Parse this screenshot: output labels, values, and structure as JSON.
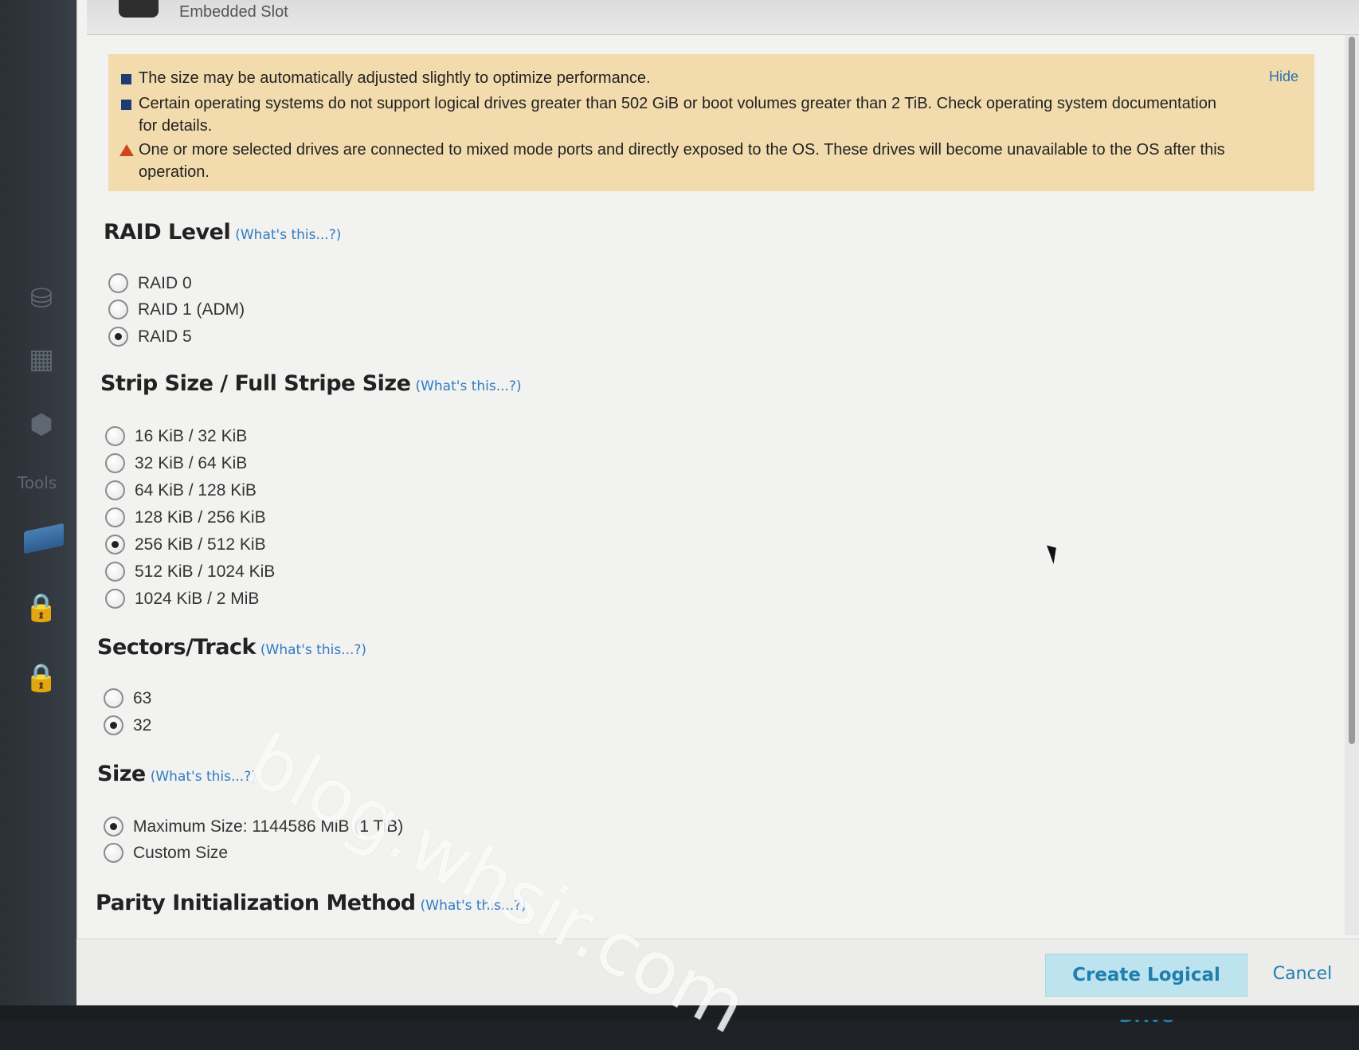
{
  "titlebar": {
    "slot_label": "Embedded Slot"
  },
  "sidebar": {
    "tools_label": "Tools"
  },
  "alert": {
    "messages": [
      "The size may be automatically adjusted slightly to optimize performance.",
      "Certain operating systems do not support logical drives greater than 502 GiB or boot volumes greater than 2 TiB. Check operating system documentation for details.",
      "One or more selected drives are connected to mixed mode ports and directly exposed to the OS. These drives will become unavailable to the OS after this operation."
    ],
    "hide_label": "Hide"
  },
  "raid_level": {
    "title": "RAID Level",
    "help": "(What's this...?)",
    "options": [
      "RAID 0",
      "RAID 1 (ADM)",
      "RAID 5"
    ],
    "selected": "RAID 5"
  },
  "strip_size": {
    "title": "Strip Size / Full Stripe Size",
    "help": "(What's this...?)",
    "options": [
      "16 KiB / 32 KiB",
      "32 KiB / 64 KiB",
      "64 KiB / 128 KiB",
      "128 KiB / 256 KiB",
      "256 KiB / 512 KiB",
      "512 KiB / 1024 KiB",
      "1024 KiB / 2 MiB"
    ],
    "selected": "256 KiB / 512 KiB"
  },
  "sectors_track": {
    "title": "Sectors/Track",
    "help": "(What's this...?)",
    "options": [
      "63",
      "32"
    ],
    "selected": "32"
  },
  "size": {
    "title": "Size",
    "help": "(What's this...?)",
    "options": [
      "Maximum Size: 1144586 MiB (1 TiB)",
      "Custom Size"
    ],
    "selected": "Maximum Size: 1144586 MiB (1 TiB)"
  },
  "parity": {
    "title": "Parity Initialization Method",
    "help": "(What's this...?)"
  },
  "footer": {
    "create_label": "Create Logical Drive",
    "cancel_label": "Cancel"
  },
  "watermark": "blog.whsir.com",
  "colors": {
    "alert_bg": "#f2dcae",
    "link": "#2f7bc4",
    "primary_button_bg": "#bde3ef",
    "warning_icon": "#d0461b",
    "bullet_icon": "#1f3b73"
  },
  "icons": [
    "database-icon",
    "server-icon",
    "network-icon",
    "drive-icon",
    "lock-icon",
    "lock-icon",
    "warning-icon",
    "bullet-icon",
    "mouse-cursor-icon"
  ]
}
